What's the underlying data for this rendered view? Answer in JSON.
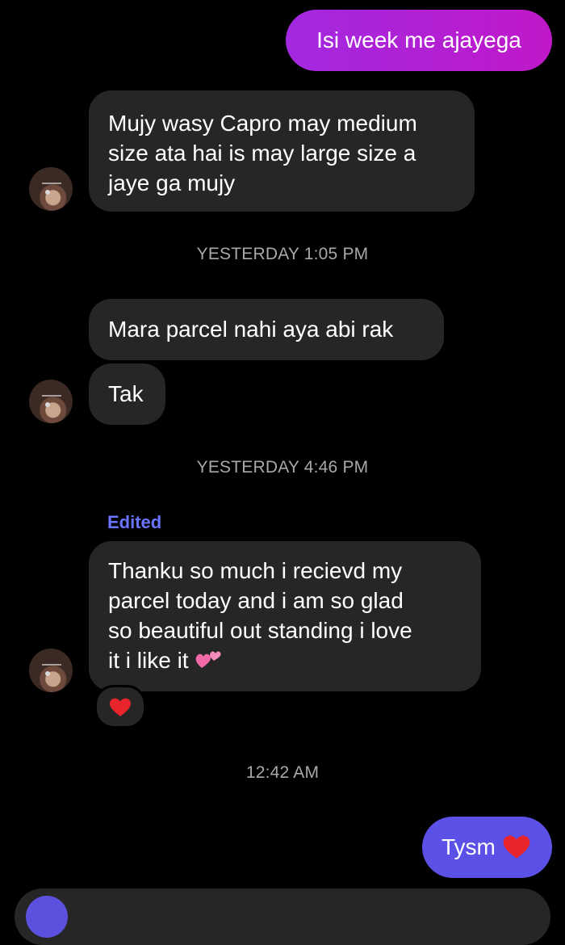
{
  "colors": {
    "background": "#000000",
    "incoming_bubble": "#262626",
    "outgoing_gradient_start": "#a229e0",
    "outgoing_gradient_end": "#c018c8",
    "outgoing_last": "#5b51e6",
    "timestamp_text": "#a8a8a8",
    "edited_label": "#6a74ff",
    "heart": "#e8242c"
  },
  "messages": [
    {
      "type": "outgoing",
      "text": "Isi week me ajayega"
    },
    {
      "type": "incoming",
      "lines": [
        "Mujy wasy Capro may medium",
        "size ata hai is may large size a",
        "jaye ga mujy"
      ],
      "avatar": "avatar"
    },
    {
      "type": "timestamp",
      "text": "YESTERDAY 1:05 PM"
    },
    {
      "type": "incoming",
      "text": "Mara parcel nahi aya abi rak"
    },
    {
      "type": "incoming",
      "text": "Tak",
      "avatar": "avatar"
    },
    {
      "type": "timestamp",
      "text": "YESTERDAY 4:46 PM"
    },
    {
      "type": "edited_label",
      "text": "Edited"
    },
    {
      "type": "incoming",
      "lines": [
        "Thanku so much i recievd my",
        "parcel today and i am so glad",
        "so beautiful out standing i love",
        "it i like it"
      ],
      "emoji": "two-hearts-emoji",
      "avatar": "avatar",
      "reaction": "red-heart"
    },
    {
      "type": "timestamp",
      "text": "12:42 AM"
    },
    {
      "type": "outgoing",
      "text": "Tysm",
      "emoji": "red-heart-emoji"
    }
  ],
  "ui": {
    "msg1": "Isi week me ajayega",
    "msg2_line1": "Mujy wasy Capro may medium",
    "msg2_line2": "size ata hai is may large size a",
    "msg2_line3": "jaye ga mujy",
    "ts1": "YESTERDAY 1:05 PM",
    "msg3": "Mara parcel nahi aya abi rak",
    "msg4": "Tak",
    "ts2": "YESTERDAY 4:46 PM",
    "edited": "Edited",
    "msg5_line1": "Thanku so much i recievd my",
    "msg5_line2": "parcel today and i am so glad",
    "msg5_line3": "so beautiful out standing i love",
    "msg5_line4": "it i like it",
    "ts3": "12:42 AM",
    "msg6": "Tysm"
  }
}
